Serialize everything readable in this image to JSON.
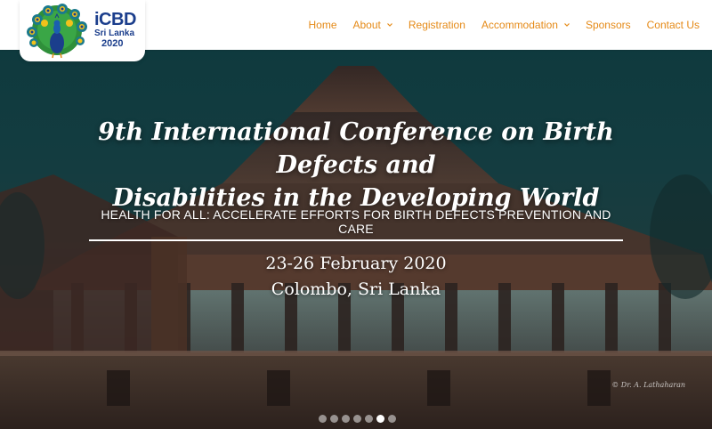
{
  "logo": {
    "brand": "iCBD",
    "location": "Sri Lanka",
    "year": "2020"
  },
  "nav": {
    "items": [
      {
        "label": "Home",
        "has_dropdown": false
      },
      {
        "label": "About",
        "has_dropdown": true
      },
      {
        "label": "Registration",
        "has_dropdown": false
      },
      {
        "label": "Accommodation",
        "has_dropdown": true
      },
      {
        "label": "Sponsors",
        "has_dropdown": false
      },
      {
        "label": "Contact Us",
        "has_dropdown": false
      }
    ]
  },
  "hero": {
    "title_line1": "9th International Conference on Birth Defects and",
    "title_line2": "Disabilities in the Developing World",
    "theme": "HEALTH FOR ALL: ACCELERATE EFFORTS FOR BIRTH DEFECTS PREVENTION AND CARE",
    "dates": "23-26 February 2020",
    "venue": "Colombo, Sri Lanka",
    "photo_credit": "© Dr. A. Lathaharan",
    "slide_count": 7,
    "active_slide": 6
  },
  "colors": {
    "nav_text": "#e58a17",
    "logo_blue": "#1b3e8c",
    "hero_sky": "#0f3a3e"
  }
}
